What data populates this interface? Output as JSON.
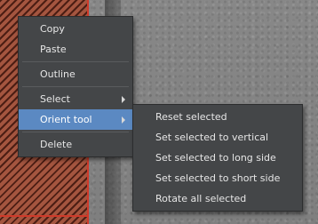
{
  "context_menu": {
    "items": [
      {
        "label": "Copy"
      },
      {
        "label": "Paste"
      },
      {
        "label": "Outline"
      },
      {
        "label": "Select"
      },
      {
        "label": "Orient tool"
      },
      {
        "label": "Delete"
      }
    ]
  },
  "orient_submenu": {
    "items": [
      {
        "label": "Reset selected"
      },
      {
        "label": "Set selected to vertical"
      },
      {
        "label": "Set selected to long side"
      },
      {
        "label": "Set selected to short side"
      },
      {
        "label": "Rotate all selected"
      }
    ]
  },
  "colors": {
    "menu_background": "#444648",
    "highlight": "#5b89c2",
    "selection_outline": "#d03a2a"
  }
}
